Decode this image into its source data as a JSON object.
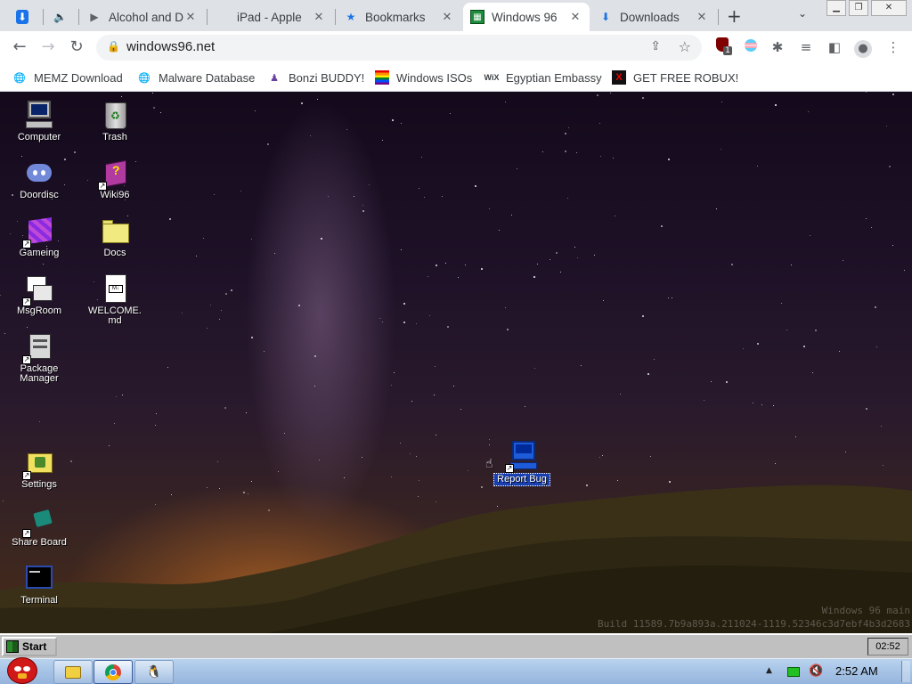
{
  "browser": {
    "tabs": [
      {
        "label": "",
        "icon": "download-icon"
      },
      {
        "label": "",
        "icon": "speaker-icon"
      },
      {
        "label": "Alcohol and D",
        "icon": "bookmark-tag-icon"
      },
      {
        "label": "iPad - Apple",
        "icon": "apple-icon"
      },
      {
        "label": "Bookmarks",
        "icon": "star-icon"
      },
      {
        "label": "Windows 96",
        "icon": "windows96-icon",
        "active": true
      },
      {
        "label": "Downloads",
        "icon": "download-icon"
      }
    ],
    "new_tab": "+",
    "url": "windows96.net",
    "bookmarks": [
      {
        "label": "MEMZ Download",
        "icon": "globe-icon"
      },
      {
        "label": "Malware Database",
        "icon": "globe-icon"
      },
      {
        "label": "Bonzi BUDDY!",
        "icon": "bonzi-icon"
      },
      {
        "label": "Windows ISOs",
        "icon": "rainbow-flag-icon"
      },
      {
        "label": "Egyptian Embassy",
        "icon": "wix-icon"
      },
      {
        "label": "GET FREE ROBUX!",
        "icon": "x-icon"
      }
    ],
    "ext_badge": "1"
  },
  "desktop": {
    "icons": [
      {
        "label": "Computer",
        "icon": "computer-icon"
      },
      {
        "label": "Trash",
        "icon": "trash-icon"
      },
      {
        "label": "Doordisc",
        "icon": "discord-icon"
      },
      {
        "label": "Wiki96",
        "icon": "book-icon"
      },
      {
        "label": "Gameing",
        "icon": "cube-icon"
      },
      {
        "label": "Docs",
        "icon": "folder-icon"
      },
      {
        "label": "MsgRoom",
        "icon": "chat-icon"
      },
      {
        "label": "WELCOME.md",
        "icon": "markdown-file-icon"
      },
      {
        "label": "Package Manager",
        "icon": "package-icon"
      },
      {
        "label": "Settings",
        "icon": "settings-icon"
      },
      {
        "label": "Share Board",
        "icon": "share-icon"
      },
      {
        "label": "Terminal",
        "icon": "terminal-icon"
      },
      {
        "label": "Report Bug",
        "icon": "bug-report-icon"
      }
    ],
    "watermark_line1": "Windows 96 main",
    "watermark_line2": "Build 11589.7b9a893a.211024-1119.52346c3d7ebf4b3d2683"
  },
  "w96_taskbar": {
    "start_label": "Start",
    "clock": "02:52"
  },
  "os_taskbar": {
    "clock": "2:52 AM"
  }
}
